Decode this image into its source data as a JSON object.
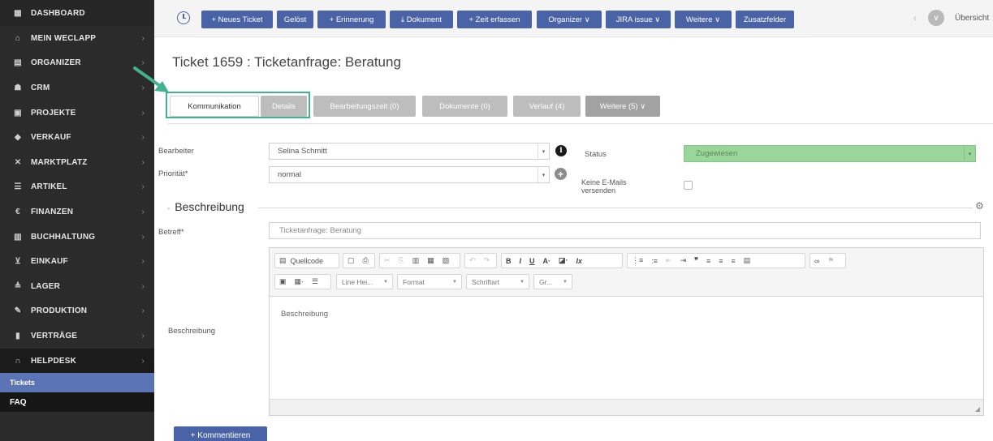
{
  "sidebar": {
    "items": [
      {
        "label": "DASHBOARD",
        "icon": "dashboard-icon",
        "glyph": "▦"
      },
      {
        "label": "MEIN WECLAPP",
        "icon": "home-icon",
        "glyph": "⌂"
      },
      {
        "label": "ORGANIZER",
        "icon": "inbox-icon",
        "glyph": "▤"
      },
      {
        "label": "CRM",
        "icon": "users-icon",
        "glyph": "☗"
      },
      {
        "label": "PROJEKTE",
        "icon": "briefcase-icon",
        "glyph": "▣"
      },
      {
        "label": "VERKAUF",
        "icon": "tag-icon",
        "glyph": "◆"
      },
      {
        "label": "MARKTPLATZ",
        "icon": "shuffle-icon",
        "glyph": "✕"
      },
      {
        "label": "ARTIKEL",
        "icon": "list-icon",
        "glyph": "☰"
      },
      {
        "label": "FINANZEN",
        "icon": "euro-icon",
        "glyph": "€"
      },
      {
        "label": "BUCHHALTUNG",
        "icon": "calculator-icon",
        "glyph": "▥"
      },
      {
        "label": "EINKAUF",
        "icon": "cart-icon",
        "glyph": "⊻"
      },
      {
        "label": "LAGER",
        "icon": "warehouse-icon",
        "glyph": "≜"
      },
      {
        "label": "PRODUKTION",
        "icon": "wrench-icon",
        "glyph": "✎"
      },
      {
        "label": "VERTRÄGE",
        "icon": "document-icon",
        "glyph": "▮"
      },
      {
        "label": "HELPDESK",
        "icon": "headset-icon",
        "glyph": "∩"
      }
    ],
    "sub": [
      {
        "label": "Tickets"
      },
      {
        "label": "FAQ"
      }
    ],
    "chevron": "›"
  },
  "toolbar": {
    "buttons": [
      {
        "label": "+ Neues Ticket"
      },
      {
        "label": "Gelöst"
      },
      {
        "label": "+ Erinnerung"
      },
      {
        "label": "⤓ Dokument"
      },
      {
        "label": "+ Zeit erfassen"
      },
      {
        "label": "Organizer ∨"
      },
      {
        "label": "JIRA issue ∨"
      },
      {
        "label": "Weitere ∨"
      },
      {
        "label": "Zusatzfelder"
      }
    ],
    "nav_arrows": "‹ ›",
    "avatar_glyph": "∨",
    "overview": "Übersicht"
  },
  "page": {
    "title": "Ticket 1659 : Ticketanfrage: Beratung"
  },
  "tabs": [
    {
      "label": "Kommunikation"
    },
    {
      "label": "Details"
    },
    {
      "label": "Bearbeitungszeit (0)"
    },
    {
      "label": "Dokumente (0)"
    },
    {
      "label": "Verlauf (4)"
    },
    {
      "label": "Weitere (5) ∨"
    }
  ],
  "form": {
    "bearbeiter_label": "Bearbeiter",
    "bearbeiter_value": "Selina Schmitt",
    "prioritaet_label": "Priorität*",
    "prioritaet_value": "normal",
    "status_label": "Status",
    "status_value": "Zugewiesen",
    "keine_mails_label_1": "Keine E-Mails",
    "keine_mails_label_2": "versenden",
    "caret": "▾",
    "info_glyph": "i",
    "plus_glyph": "+"
  },
  "section": {
    "title": "Beschreibung",
    "toggle": "-",
    "gear": "⚙"
  },
  "betreff": {
    "label": "Betreff*",
    "value": "Ticketanfrage: Beratung"
  },
  "description": {
    "label": "Beschreibung",
    "content": "Beschreibung"
  },
  "editor": {
    "source_label": "Quellcode",
    "bold": "B",
    "italic": "I",
    "underline": "U",
    "font_color": "A·",
    "bg_color": "◪·",
    "clear": "Ix",
    "quote": "❞",
    "combos": [
      {
        "label": "Line Hei..."
      },
      {
        "label": "Format"
      },
      {
        "label": "Schriftart"
      },
      {
        "label": "Gr..."
      }
    ]
  },
  "comment_button": "+ Kommentieren",
  "colors": {
    "accent": "#4a63a6",
    "status_green": "#9ad59a",
    "highlight": "#42b38e",
    "sidebar": "#2b2b2b",
    "selected_sub": "#5b74b5"
  }
}
